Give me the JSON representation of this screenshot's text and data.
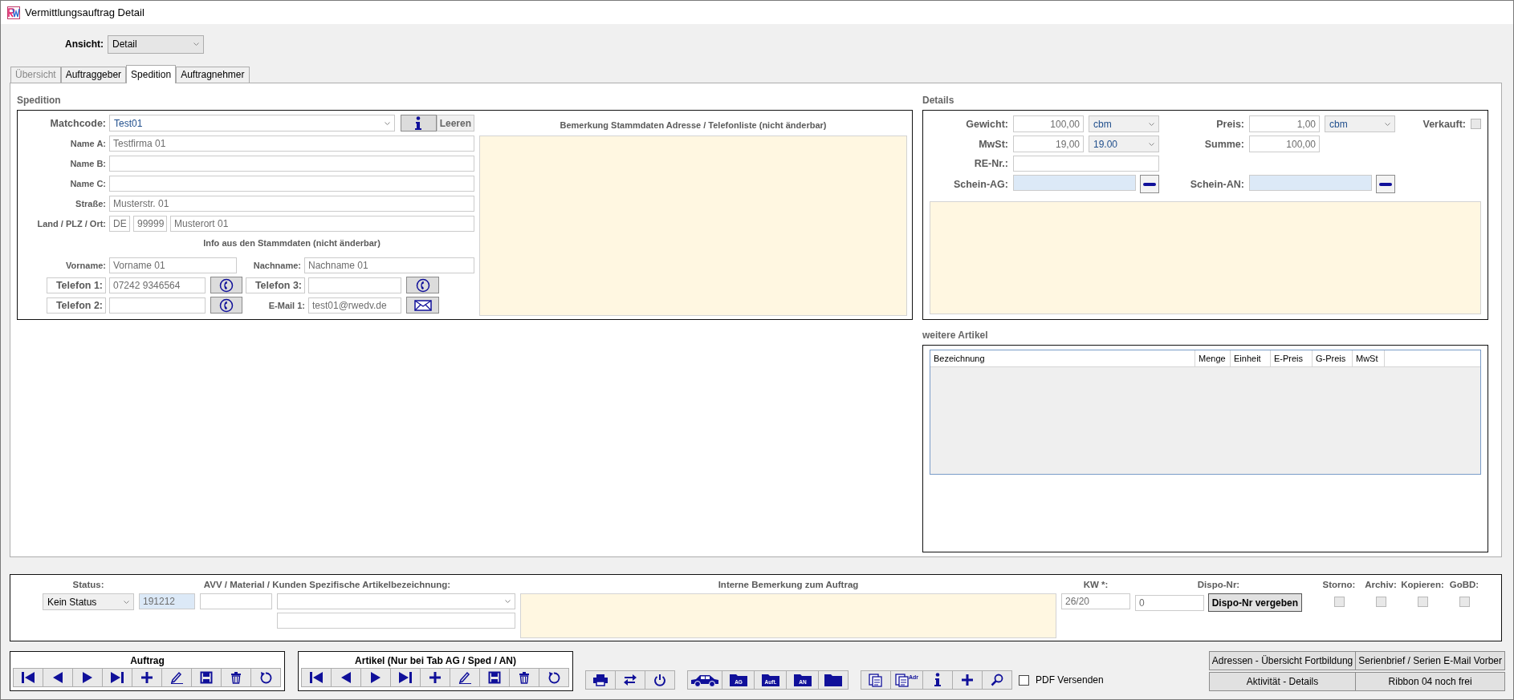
{
  "window": {
    "title": "Vermittlungsauftrag Detail"
  },
  "view": {
    "label": "Ansicht:",
    "value": "Detail"
  },
  "tabs": [
    {
      "label": "Übersicht",
      "selected": false,
      "disabled": true
    },
    {
      "label": "Auftraggeber",
      "selected": false,
      "disabled": false
    },
    {
      "label": "Spedition",
      "selected": true,
      "disabled": false
    },
    {
      "label": "Auftragnehmer",
      "selected": false,
      "disabled": false
    }
  ],
  "spedition": {
    "title": "Spedition",
    "matchcode": {
      "label": "Matchcode:",
      "value": "Test01"
    },
    "clear_button": "Leeren",
    "name_fields": [
      {
        "label": "Name A:",
        "value": "Testfirma 01"
      },
      {
        "label": "Name B:"
      },
      {
        "label": "Name C:"
      },
      {
        "label": "Straße:",
        "value": "Musterstr. 01"
      }
    ],
    "location": {
      "label": "Land / PLZ / Ort:",
      "country": "DE",
      "zip": "99999",
      "city": "Musterort 01"
    },
    "info_heading": "Info aus den Stammdaten (nicht änderbar)",
    "first_name": {
      "label": "Vorname:",
      "value": "Vorname 01"
    },
    "last_name": {
      "label": "Nachname:",
      "value": "Nachname 01"
    },
    "phones": [
      {
        "label": "Telefon 1:",
        "value": "07242 9346564"
      },
      {
        "label": "Telefon 3:"
      },
      {
        "label": "Telefon 2:"
      }
    ],
    "email": {
      "label": "E-Mail 1:",
      "value": "test01@rwedv.de"
    },
    "remark_heading": "Bemerkung Stammdaten Adresse / Telefonliste (nicht änderbar)"
  },
  "details": {
    "title": "Details",
    "weight": {
      "label": "Gewicht:",
      "value": "100,00",
      "unit": "cbm"
    },
    "price": {
      "label": "Preis:",
      "value": "1,00",
      "unit": "cbm"
    },
    "sold": {
      "label": "Verkauft:",
      "checked": false
    },
    "vat": {
      "label": "MwSt:",
      "value": "19,00",
      "rate": "19.00"
    },
    "sum": {
      "label": "Summe:",
      "value": "100,00"
    },
    "invoice": {
      "label": "RE-Nr.:"
    },
    "slip_ag": {
      "label": "Schein-AG:"
    },
    "slip_an": {
      "label": "Schein-AN:"
    }
  },
  "articles": {
    "title": "weitere Artikel",
    "columns": [
      "Bezeichnung",
      "Menge",
      "Einheit",
      "E-Preis",
      "G-Preis",
      "MwSt"
    ]
  },
  "order_info": {
    "status": {
      "label": "Status:",
      "value": "Kein Status"
    },
    "avv": {
      "label": "AVV / Material / Kunden Spezifische Artikelbezeichnung:",
      "code": "191212"
    },
    "remark": {
      "label": "Interne Bemerkung zum Auftrag"
    },
    "week": {
      "label": "KW *:",
      "value": "26/20"
    },
    "dispo": {
      "label": "Dispo-Nr:",
      "value": "0",
      "button": "Dispo-Nr vergeben"
    },
    "flags": [
      {
        "label": "Storno:",
        "checked": false
      },
      {
        "label": "Archiv:",
        "checked": false
      },
      {
        "label": "Kopieren:",
        "checked": false
      },
      {
        "label": "GoBD:",
        "checked": false
      }
    ]
  },
  "toolbars": [
    {
      "title": "Auftrag",
      "buttons": [
        {
          "kind": "first"
        },
        {
          "kind": "prev"
        },
        {
          "kind": "next"
        },
        {
          "kind": "last"
        },
        {
          "kind": "add"
        },
        {
          "kind": "edit"
        },
        {
          "kind": "save"
        },
        {
          "kind": "delete"
        },
        {
          "kind": "undo"
        }
      ]
    },
    {
      "title": "Artikel (Nur bei Tab AG / Sped / AN)",
      "buttons": [
        {
          "kind": "first"
        },
        {
          "kind": "prev"
        },
        {
          "kind": "next"
        },
        {
          "kind": "last"
        },
        {
          "kind": "add"
        },
        {
          "kind": "edit"
        },
        {
          "kind": "save"
        },
        {
          "kind": "delete"
        },
        {
          "kind": "undo"
        }
      ]
    }
  ],
  "tool_groups": [
    [
      {
        "kind": "print"
      },
      {
        "kind": "swap"
      },
      {
        "kind": "power"
      }
    ],
    [
      {
        "kind": "car"
      },
      {
        "kind": "folder",
        "text": "AG"
      },
      {
        "kind": "folder",
        "text": "Auft."
      },
      {
        "kind": "folder",
        "text": "AN"
      },
      {
        "kind": "folder"
      }
    ],
    [
      {
        "kind": "copy"
      },
      {
        "kind": "copy",
        "text": "Adr"
      },
      {
        "kind": "info"
      },
      {
        "kind": "add"
      },
      {
        "kind": "search"
      }
    ]
  ],
  "pdf": {
    "label": "PDF Versenden",
    "checked": false
  },
  "ribbon": [
    "Adressen - Übersicht Fortbildung",
    "Serienbrief / Serien E-Mail Vorber",
    "Aktivität - Details",
    "Ribbon 04 noch frei"
  ]
}
